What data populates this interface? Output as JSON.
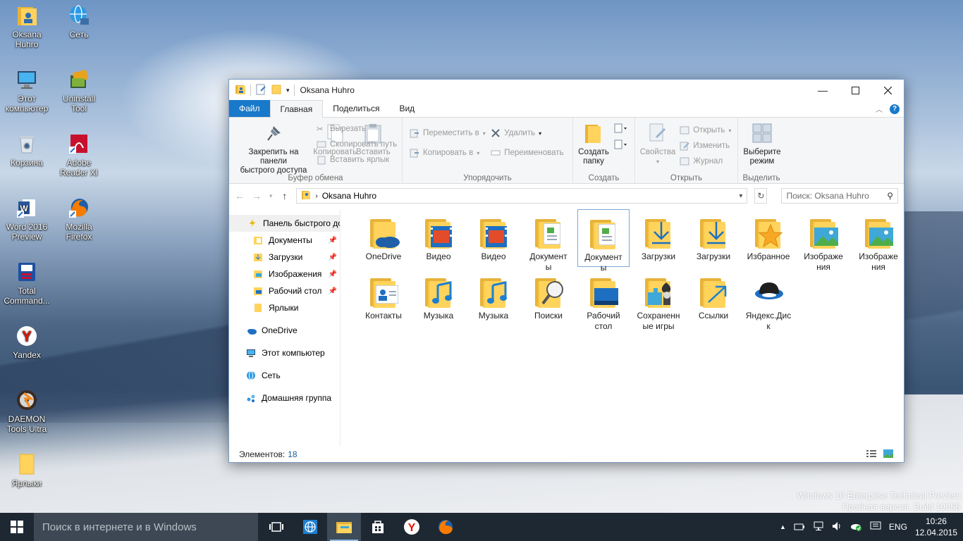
{
  "desktop": {
    "icons": [
      {
        "label": "Oksana\nHuhro"
      },
      {
        "label": "Сеть"
      },
      {
        "label": "Этот\nкомпьютер"
      },
      {
        "label": "Uninstall\nTool"
      },
      {
        "label": "Корзина"
      },
      {
        "label": "Adobe\nReader XI"
      },
      {
        "label": "Word 2016\nPreview"
      },
      {
        "label": "Mozilla\nFirefox"
      },
      {
        "label": "Total\nCommand..."
      },
      {
        "label": "Yandex"
      },
      {
        "label": "DAEMON\nTools Ultra"
      },
      {
        "label": "Ярлыки"
      }
    ],
    "watermark_line1": "Windows 10 Enterprise Technical Preview",
    "watermark_line2": "Пробная версия. Build 10056"
  },
  "window": {
    "title": "Oksana Huhro",
    "tabs": {
      "file": "Файл",
      "home": "Главная",
      "share": "Поделиться",
      "view": "Вид"
    },
    "ribbon": {
      "clipboard": {
        "name": "Буфер обмена",
        "pin": "Закрепить на панели\nбыстрого доступа",
        "copy": "Копировать",
        "paste": "Вставить",
        "cut": "Вырезать",
        "copy_path": "Скопировать путь",
        "paste_shortcut": "Вставить ярлык"
      },
      "organize": {
        "name": "Упорядочить",
        "move_to": "Переместить в",
        "copy_to": "Копировать в",
        "delete": "Удалить",
        "rename": "Переименовать"
      },
      "create": {
        "name": "Создать",
        "new_folder": "Создать\nпапку"
      },
      "open": {
        "name": "Открыть",
        "properties": "Свойства",
        "open": "Открыть",
        "edit": "Изменить",
        "history": "Журнал"
      },
      "select": {
        "name": "Выделить",
        "select_mode": "Выберите\nрежим"
      }
    },
    "address": {
      "path": "Oksana Huhro",
      "search_placeholder": "Поиск: Oksana Huhro"
    },
    "nav": {
      "quick_access": "Панель быстрого до",
      "items": [
        {
          "label": "Документы"
        },
        {
          "label": "Загрузки"
        },
        {
          "label": "Изображения"
        },
        {
          "label": "Рабочий стол"
        },
        {
          "label": "Ярлыки"
        }
      ],
      "onedrive": "OneDrive",
      "this_pc": "Этот компьютер",
      "network": "Сеть",
      "homegroup": "Домашняя группа"
    },
    "files": [
      {
        "label": "OneDrive"
      },
      {
        "label": "Видео"
      },
      {
        "label": "Видео"
      },
      {
        "label": "Документ\nы"
      },
      {
        "label": "Документ\nы"
      },
      {
        "label": "Загрузки"
      },
      {
        "label": "Загрузки"
      },
      {
        "label": "Избранное"
      },
      {
        "label": "Изображе\nния"
      },
      {
        "label": "Изображе\nния"
      },
      {
        "label": "Контакты"
      },
      {
        "label": "Музыка"
      },
      {
        "label": "Музыка"
      },
      {
        "label": "Поиски"
      },
      {
        "label": "Рабочий\nстол"
      },
      {
        "label": "Сохраненн\nые игры"
      },
      {
        "label": "Ссылки"
      },
      {
        "label": "Яндекс.Дис\nк"
      }
    ],
    "status": {
      "label": "Элементов:",
      "count": "18"
    }
  },
  "taskbar": {
    "search_placeholder": "Поиск в интернете и в Windows",
    "lang": "ENG",
    "time": "10:26",
    "date": "12.04.2015"
  },
  "colors": {
    "accent": "#1979ca",
    "folder": "#ffd35c",
    "taskbar": "#1e2833"
  }
}
